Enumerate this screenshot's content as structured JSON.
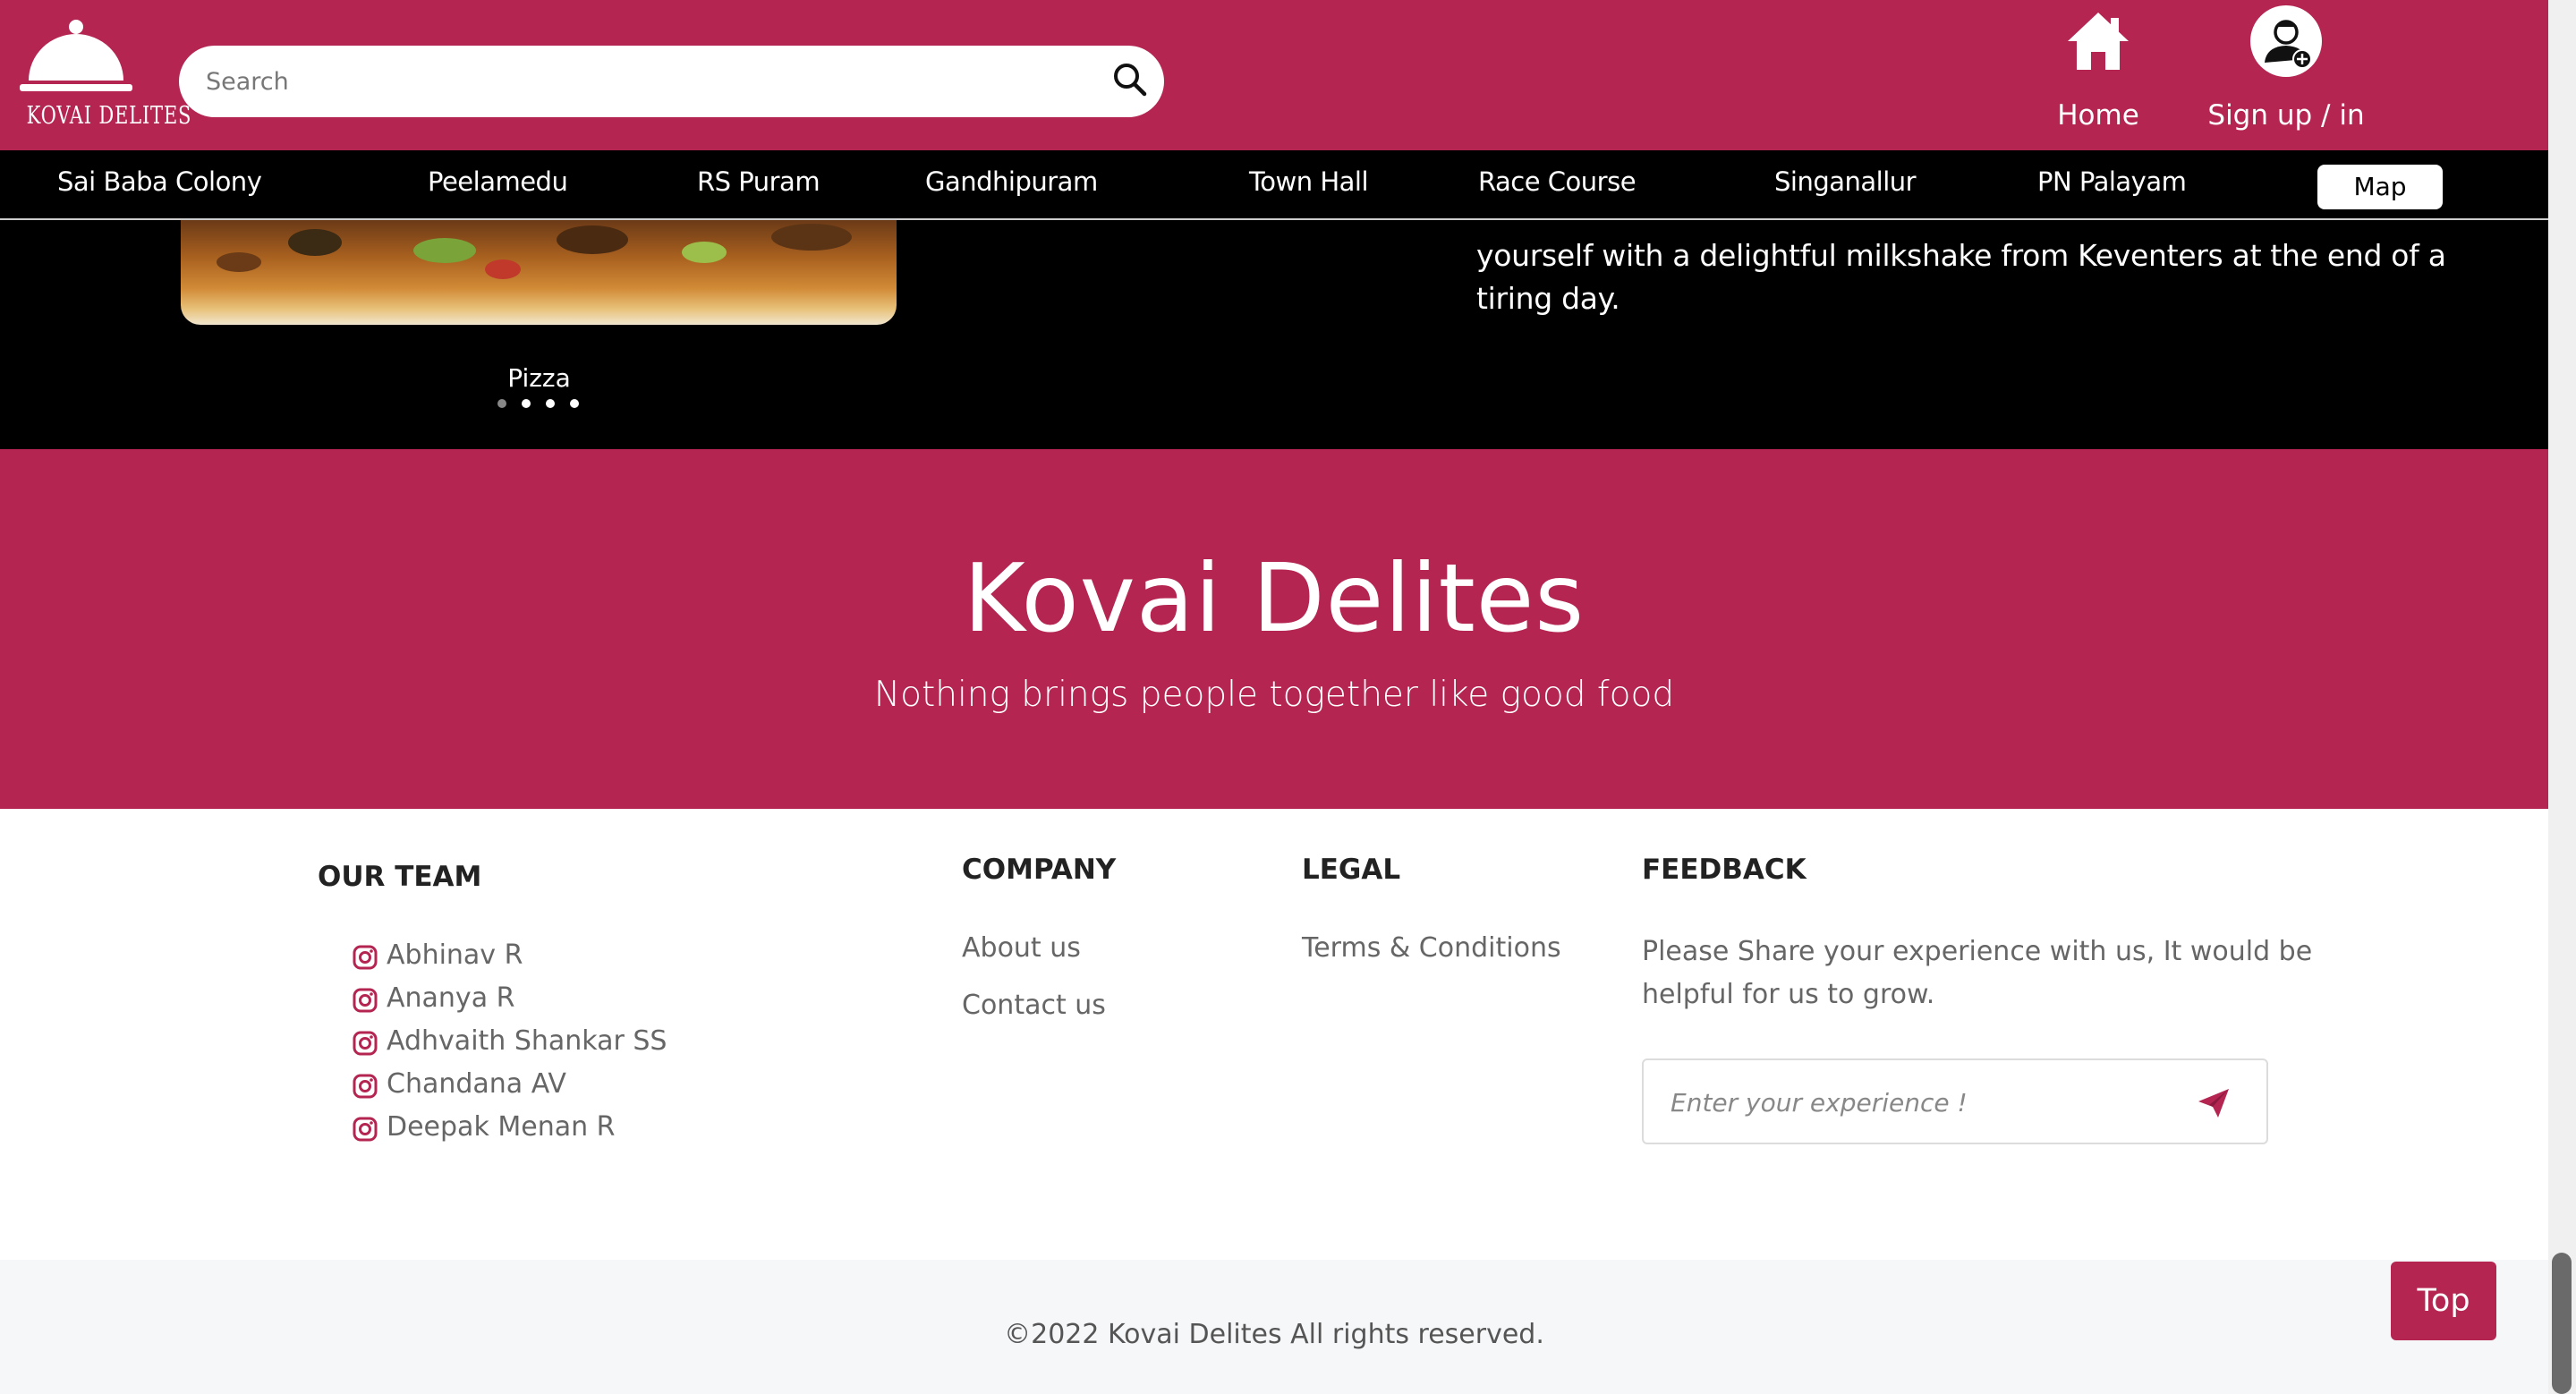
{
  "brand": {
    "logo_text": "KOVAI DELITES",
    "accent_color": "#b52552"
  },
  "header": {
    "search_placeholder": "Search",
    "home_label": "Home",
    "signup_label": "Sign up / in"
  },
  "locations": [
    "Sai Baba Colony",
    "Peelamedu",
    "RS Puram",
    "Gandhipuram",
    "Town Hall",
    "Race Course",
    "Singanallur",
    "PN Palayam"
  ],
  "map_button": "Map",
  "carousel": {
    "caption": "Pizza",
    "slides": 4,
    "active_slide": 1,
    "description": "yourself with a delightful milkshake from Keventers at the end of a tiring day."
  },
  "banner": {
    "title": "Kovai Delites",
    "tagline": "Nothing brings people together like good food"
  },
  "footer": {
    "team_title": "OUR TEAM",
    "team": [
      "Abhinav R",
      "Ananya R",
      "Adhvaith Shankar SS",
      "Chandana AV",
      "Deepak Menan R"
    ],
    "company_title": "COMPANY",
    "company_links": [
      "About us",
      "Contact us"
    ],
    "legal_title": "LEGAL",
    "legal_links": [
      "Terms & Conditions"
    ],
    "feedback_title": "FEEDBACK",
    "feedback_text": "Please Share your experience with us, It would be helpful for us to grow.",
    "feedback_placeholder": "Enter your experience !"
  },
  "copyright": "©2022 Kovai Delites All rights reserved.",
  "top_button": "Top"
}
